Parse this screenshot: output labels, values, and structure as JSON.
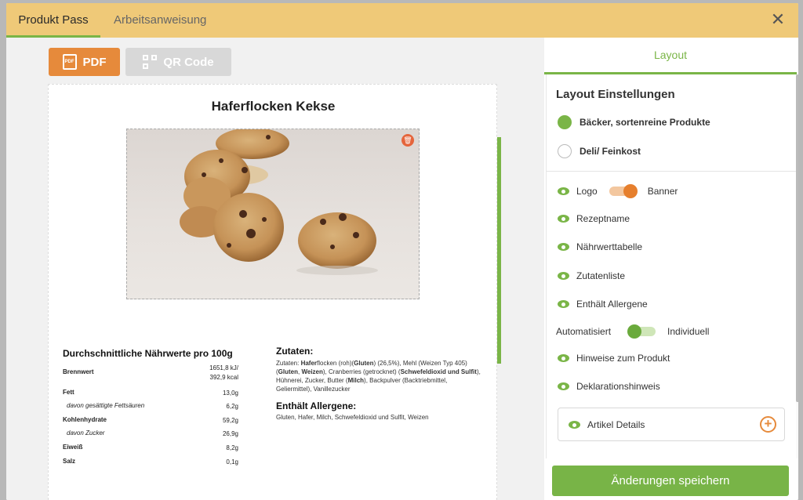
{
  "tabs": [
    {
      "label": "Produkt Pass",
      "active": true
    },
    {
      "label": "Arbeitsanweisung",
      "active": false
    }
  ],
  "toolbar": {
    "pdf_label": "PDF",
    "qr_label": "QR Code"
  },
  "preview": {
    "title": "Haferflocken Kekse",
    "nutrition": {
      "title": "Durchschnittliche Nährwerte pro 100g",
      "rows": [
        {
          "label": "Brennwert",
          "value": "1651,8 kJ/",
          "value2": "392,9 kcal"
        },
        {
          "label": "Fett",
          "value": "13,0g"
        },
        {
          "label": "davon gesättigte Fettsäuren",
          "value": "6,2g"
        },
        {
          "label": "Kohlenhydrate",
          "value": "59,2g"
        },
        {
          "label": "davon Zucker",
          "value": "26,9g"
        },
        {
          "label": "Eiweiß",
          "value": "8,2g"
        },
        {
          "label": "Salz",
          "value": "0,1g"
        }
      ]
    },
    "zutaten": {
      "title": "Zutaten:",
      "text_parts": [
        "Zutaten: ",
        "Hafer",
        "flocken (roh)(",
        "Gluten",
        ") (26,5%), Mehl (Weizen Typ 405) (",
        "Gluten",
        ", ",
        "Weizen",
        "), Cranberries (getrocknet) (",
        "Schwefeldioxid und Sulfit",
        "), Hühnerei, Zucker, Butter (",
        "Milch",
        "), Backpulver (Backtriebmittel, Geliermittel), Vanillezucker"
      ]
    },
    "allergene": {
      "title": "Enthält Allergene:",
      "text": "Gluten, Hafer, Milch, Schwefeldioxid und Sulfit, Weizen"
    }
  },
  "panel": {
    "tab": "Layout",
    "title": "Layout Einstellungen",
    "radios": [
      {
        "label": "Bäcker, sortenreine Produkte",
        "selected": true
      },
      {
        "label": "Deli/ Feinkost",
        "selected": false
      }
    ],
    "logo_label": "Logo",
    "banner_label": "Banner",
    "options": [
      "Rezeptname",
      "Nährwerttabelle",
      "Zutatenliste",
      "Enthält Allergene"
    ],
    "auto_label": "Automatisiert",
    "indiv_label": "Individuell",
    "options2": [
      "Hinweise zum Produkt",
      "Deklarationshinweis"
    ],
    "details_label": "Artikel Details",
    "save_label": "Änderungen speichern"
  },
  "colors": {
    "accent_green": "#7ab547",
    "accent_orange": "#e68a3b",
    "header_yellow": "#efc978"
  },
  "icons": [
    "close-icon",
    "pdf-icon",
    "qr-code-icon",
    "trash-icon",
    "eye-icon",
    "plus-circle-icon"
  ]
}
